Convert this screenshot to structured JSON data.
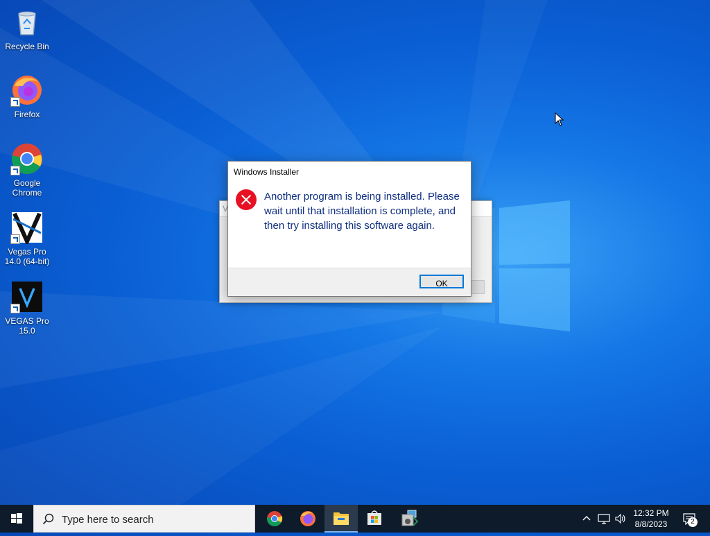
{
  "desktop": {
    "icons": [
      {
        "label": "Recycle Bin",
        "icon": "recycle-bin-icon"
      },
      {
        "label": "Firefox",
        "icon": "firefox-icon"
      },
      {
        "label": "Google Chrome",
        "icon": "chrome-icon"
      },
      {
        "label": "Vegas Pro 14.0 (64-bit)",
        "icon": "vegas-pro-14-icon"
      },
      {
        "label": "VEGAS Pro 15.0",
        "icon": "vegas-pro-15-icon"
      }
    ]
  },
  "background_window": {
    "title_fragment": "V"
  },
  "dialog": {
    "title": "Windows Installer",
    "message": "Another program is being installed. Please wait until that installation is complete, and then try installing this software again.",
    "ok_label": "OK",
    "icon": "error-icon"
  },
  "taskbar": {
    "search_placeholder": "Type here to search",
    "pinned": [
      {
        "icon": "chrome-icon"
      },
      {
        "icon": "firefox-icon"
      },
      {
        "icon": "file-explorer-icon",
        "active": true
      },
      {
        "icon": "microsoft-store-icon"
      },
      {
        "icon": "installer-icon"
      }
    ],
    "time": "12:32 PM",
    "date": "8/8/2023",
    "notification_count": "2"
  },
  "colors": {
    "desktop_blue": "#0a5fd4",
    "taskbar": "#0d1b2a",
    "error_red": "#e81123",
    "accent": "#0078d7"
  }
}
